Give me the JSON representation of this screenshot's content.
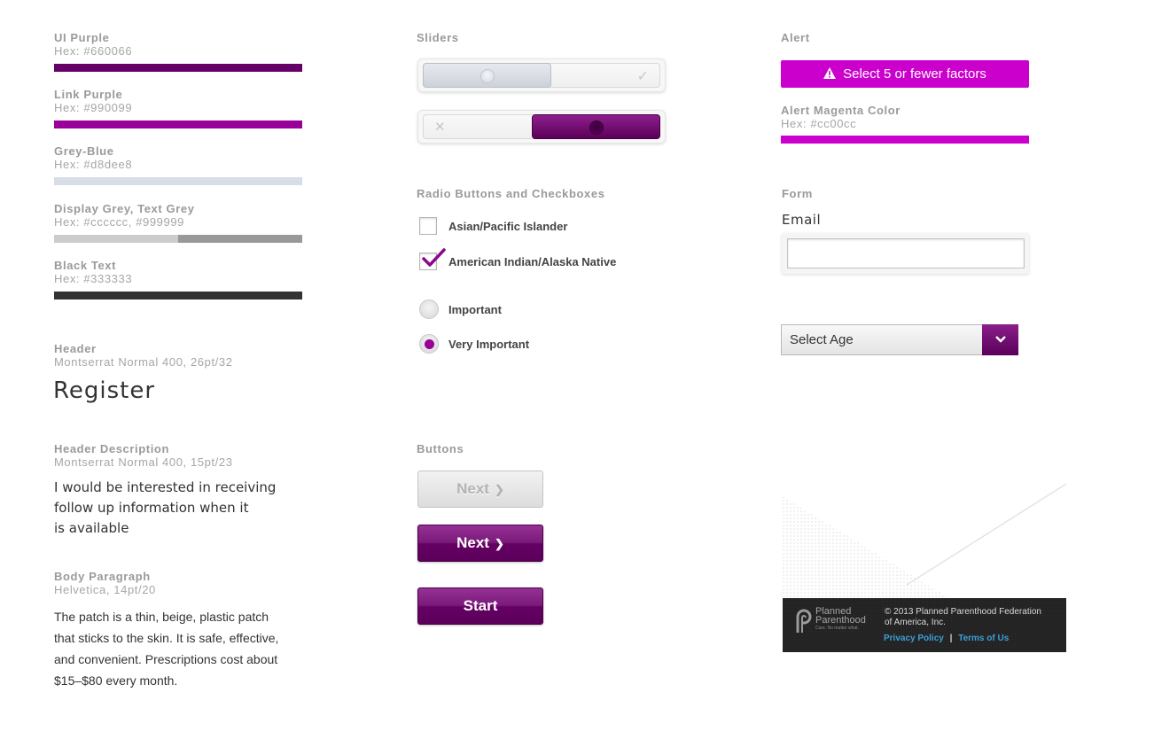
{
  "palette": {
    "items": [
      {
        "name": "UI Purple",
        "hex": "Hex: #660066",
        "color": "#660066"
      },
      {
        "name": "Link Purple",
        "hex": "Hex: #990099",
        "color": "#990099"
      },
      {
        "name": "Grey-Blue",
        "hex": "Hex: #d8dee8",
        "color": "#d8dee8"
      },
      {
        "name": "Display Grey, Text Grey",
        "hex": "Hex: #cccccc, #999999",
        "colors": [
          "#cccccc",
          "#999999"
        ]
      },
      {
        "name": "Black Text",
        "hex": "Hex: #333333",
        "color": "#333333"
      }
    ]
  },
  "typography": {
    "header": {
      "label": "Header",
      "spec": "Montserrat Normal 400, 26pt/32",
      "sample": "Register"
    },
    "header_description": {
      "label": "Header Description",
      "spec": "Montserrat Normal 400, 15pt/23",
      "sample_lines": [
        "I would be interested in receiving",
        "follow up information when it",
        "is available"
      ]
    },
    "body": {
      "label": "Body Paragraph",
      "spec": "Helvetica, 14pt/20",
      "sample_lines": [
        "The patch is a thin, beige, plastic patch",
        "that sticks to the skin. It is safe, effective,",
        "and convenient. Prescriptions cost about",
        "$15–$80 every month."
      ]
    }
  },
  "sliders": {
    "label": "Sliders",
    "check_glyph": "✓",
    "x_glyph": "✕"
  },
  "choices": {
    "label": "Radio Buttons and Checkboxes",
    "checkboxes": [
      {
        "label": "Asian/Pacific Islander",
        "checked": false
      },
      {
        "label": "American Indian/Alaska Native",
        "checked": true
      }
    ],
    "radios": [
      {
        "label": "Important",
        "selected": false
      },
      {
        "label": "Very Important",
        "selected": true
      }
    ]
  },
  "buttons": {
    "label": "Buttons",
    "next_disabled": "Next",
    "next": "Next",
    "start": "Start",
    "chevron": "❯"
  },
  "alert": {
    "label": "Alert",
    "message": "Select 5 or fewer factors",
    "icon": "warning-icon",
    "color_label": "Alert Magenta Color",
    "color_hex": "Hex: #cc00cc",
    "color": "#cc00cc"
  },
  "form": {
    "label": "Form",
    "email_label": "Email",
    "email_value": "",
    "select_value": "Select Age"
  },
  "footer": {
    "logo_line1": "Planned",
    "logo_line2": "Parenthood",
    "logo_tagline": "Care. No matter what.",
    "copyright_line1": "© 2013 Planned Parenthood Federation",
    "copyright_line2": "of America, Inc.",
    "privacy": "Privacy Policy",
    "separator": "|",
    "terms": "Terms of Us"
  }
}
